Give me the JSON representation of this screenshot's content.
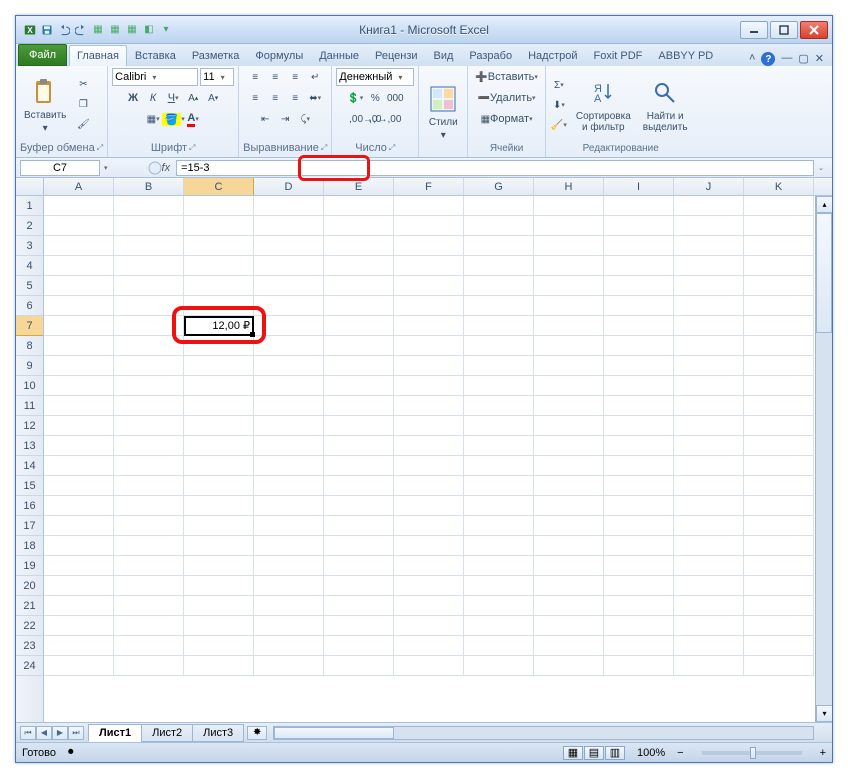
{
  "title": "Книга1 - Microsoft Excel",
  "tabs": {
    "file": "Файл",
    "items": [
      "Главная",
      "Вставка",
      "Разметка",
      "Формулы",
      "Данные",
      "Рецензи",
      "Вид",
      "Разрабо",
      "Надстрой",
      "Foxit PDF",
      "ABBYY PD"
    ],
    "active_index": 0
  },
  "ribbon": {
    "clipboard": {
      "paste": "Вставить",
      "label": "Буфер обмена"
    },
    "font": {
      "name": "Calibri",
      "size": "11",
      "label": "Шрифт"
    },
    "alignment": {
      "label": "Выравнивание"
    },
    "number": {
      "format": "Денежный",
      "label": "Число"
    },
    "styles": {
      "label": "Стили"
    },
    "cells": {
      "insert": "Вставить",
      "delete": "Удалить",
      "format": "Формат",
      "label": "Ячейки"
    },
    "editing": {
      "sort": "Сортировка\nи фильтр",
      "find": "Найти и\nвыделить",
      "label": "Редактирование"
    }
  },
  "name_box": {
    "value": "C7"
  },
  "formula_bar": {
    "value": "=15-3"
  },
  "columns": [
    "A",
    "B",
    "C",
    "D",
    "E",
    "F",
    "G",
    "H",
    "I",
    "J",
    "K"
  ],
  "rows_visible": 24,
  "active_cell": {
    "col": 2,
    "row": 6,
    "value": "12,00 ₽"
  },
  "sheets": {
    "items": [
      "Лист1",
      "Лист2",
      "Лист3"
    ],
    "active_index": 0
  },
  "status": {
    "ready": "Готово",
    "zoom": "100%"
  },
  "highlight_formula": true,
  "highlight_cell": true
}
